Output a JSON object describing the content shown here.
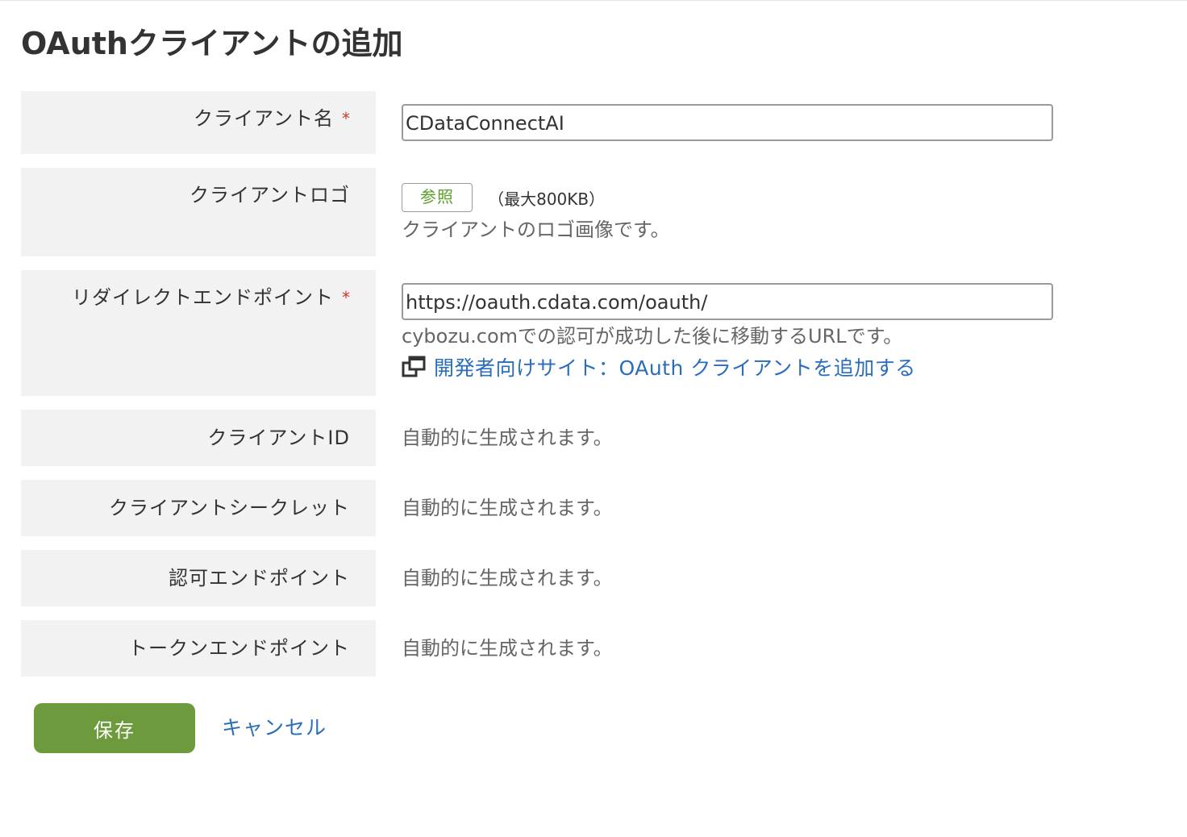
{
  "page": {
    "title": "OAuthクライアントの追加"
  },
  "form": {
    "client_name": {
      "label": "クライアント名",
      "required_mark": "*",
      "value": "CDataConnectAI"
    },
    "client_logo": {
      "label": "クライアントロゴ",
      "browse_label": "参照",
      "max_size": "（最大800KB）",
      "hint": "クライアントのロゴ画像です。"
    },
    "redirect_endpoint": {
      "label": "リダイレクトエンドポイント",
      "required_mark": "*",
      "value": "https://oauth.cdata.com/oauth/",
      "hint": "cybozu.comでの認可が成功した後に移動するURLです。",
      "link_text": "開発者向けサイト：OAuth クライアントを追加する"
    },
    "client_id": {
      "label": "クライアントID",
      "value": "自動的に生成されます。"
    },
    "client_secret": {
      "label": "クライアントシークレット",
      "value": "自動的に生成されます。"
    },
    "authorization_endpoint": {
      "label": "認可エンドポイント",
      "value": "自動的に生成されます。"
    },
    "token_endpoint": {
      "label": "トークンエンドポイント",
      "value": "自動的に生成されます。"
    }
  },
  "actions": {
    "save_label": "保存",
    "cancel_label": "キャンセル"
  },
  "colors": {
    "accent_green": "#6c9a3c",
    "link_blue": "#2a6ebb",
    "required_red": "#d0392b",
    "label_background": "#f2f2f2"
  },
  "icons": {
    "external_link": "external-window-icon"
  }
}
